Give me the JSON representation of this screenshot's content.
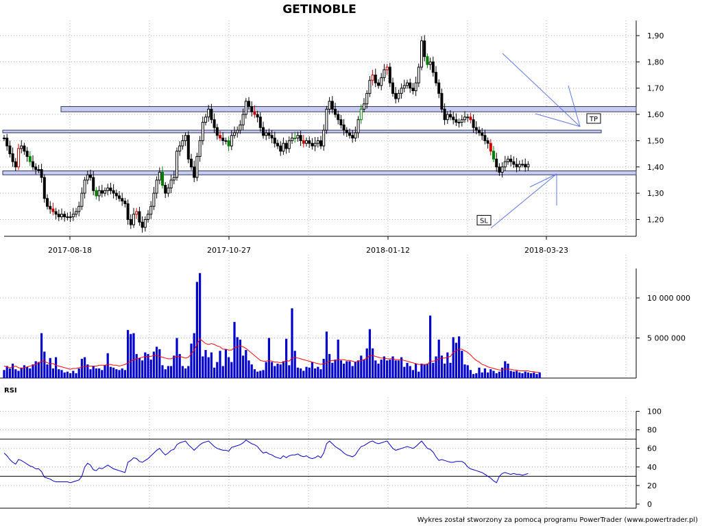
{
  "title": "GETINOBLE",
  "footer": "Wykres został stworzony za pomocą programu PowerTrader (www.powertrader.pl)",
  "colors": {
    "candle_up": "#008000",
    "candle_down": "#cc0000",
    "candle_neutral": "#000000",
    "volume_bar": "#0000cc",
    "volume_ma": "#ff0000",
    "rsi_line": "#0000cc",
    "zone_fill": "#c8cdf0",
    "zone_stroke": "#333366",
    "arrow": "#5a78e6",
    "grid": "#aaaaaa"
  },
  "chart_data": [
    {
      "type": "candlestick",
      "name": "price",
      "title": "GETINOBLE",
      "x_tick_labels": [
        "2017-08-18",
        "2017-10-27",
        "2018-01-12",
        "2018-03-23"
      ],
      "y_tick_labels": [
        "1,90",
        "1,80",
        "1,70",
        "1,60",
        "1,50",
        "1,40",
        "1,30",
        "1,20"
      ],
      "ylim": [
        1.15,
        1.92
      ],
      "grid": true,
      "close": [
        1.51,
        1.48,
        1.45,
        1.42,
        1.4,
        1.47,
        1.48,
        1.46,
        1.44,
        1.42,
        1.4,
        1.39,
        1.39,
        1.36,
        1.28,
        1.25,
        1.24,
        1.23,
        1.22,
        1.21,
        1.22,
        1.21,
        1.21,
        1.21,
        1.22,
        1.23,
        1.25,
        1.3,
        1.35,
        1.37,
        1.36,
        1.31,
        1.29,
        1.31,
        1.3,
        1.31,
        1.32,
        1.31,
        1.3,
        1.29,
        1.28,
        1.27,
        1.26,
        1.2,
        1.18,
        1.22,
        1.23,
        1.19,
        1.17,
        1.2,
        1.22,
        1.25,
        1.3,
        1.35,
        1.38,
        1.33,
        1.3,
        1.32,
        1.35,
        1.36,
        1.46,
        1.48,
        1.5,
        1.52,
        1.43,
        1.4,
        1.36,
        1.44,
        1.5,
        1.57,
        1.59,
        1.62,
        1.58,
        1.55,
        1.52,
        1.51,
        1.5,
        1.5,
        1.48,
        1.52,
        1.53,
        1.54,
        1.56,
        1.6,
        1.65,
        1.63,
        1.61,
        1.6,
        1.59,
        1.55,
        1.52,
        1.53,
        1.52,
        1.51,
        1.49,
        1.48,
        1.46,
        1.49,
        1.47,
        1.5,
        1.51,
        1.51,
        1.52,
        1.5,
        1.49,
        1.5,
        1.49,
        1.48,
        1.49,
        1.5,
        1.48,
        1.54,
        1.62,
        1.65,
        1.62,
        1.6,
        1.58,
        1.56,
        1.54,
        1.53,
        1.52,
        1.51,
        1.53,
        1.58,
        1.62,
        1.64,
        1.68,
        1.73,
        1.75,
        1.72,
        1.71,
        1.74,
        1.77,
        1.78,
        1.72,
        1.68,
        1.66,
        1.68,
        1.7,
        1.71,
        1.72,
        1.7,
        1.69,
        1.72,
        1.78,
        1.88,
        1.82,
        1.79,
        1.8,
        1.76,
        1.72,
        1.68,
        1.62,
        1.58,
        1.6,
        1.59,
        1.58,
        1.57,
        1.57,
        1.58,
        1.59,
        1.59,
        1.58,
        1.55,
        1.54,
        1.53,
        1.52,
        1.5,
        1.49,
        1.46,
        1.43,
        1.4,
        1.38,
        1.4,
        1.42,
        1.43,
        1.42,
        1.41,
        1.4,
        1.41,
        1.41,
        1.4,
        1.41
      ],
      "overlays": [
        {
          "kind": "horizontal_band",
          "y_range": [
            1.61,
            1.63
          ]
        },
        {
          "kind": "horizontal_band",
          "y_range": [
            1.53,
            1.54
          ]
        },
        {
          "kind": "horizontal_band",
          "y_range": [
            1.37,
            1.385
          ]
        }
      ],
      "annotations": [
        {
          "text": "TP",
          "y": 1.58
        },
        {
          "text": "SL",
          "y": 1.2
        }
      ]
    },
    {
      "type": "bar",
      "name": "volume",
      "y_tick_labels": [
        "10 000 000",
        "5 000 000"
      ],
      "ylim": [
        0,
        13500000
      ],
      "values": [
        1000000,
        1500000,
        1200000,
        1800000,
        1100000,
        900000,
        1300000,
        1600000,
        1400000,
        1200000,
        1700000,
        2100000,
        2000000,
        5600000,
        3300000,
        1700000,
        2500000,
        1200000,
        2600000,
        1100000,
        1000000,
        700000,
        800000,
        600000,
        900000,
        600000,
        1200000,
        2400000,
        2600000,
        1700000,
        1100000,
        1500000,
        1200000,
        1200000,
        1000000,
        1600000,
        3100000,
        1400000,
        1300000,
        1100000,
        1000000,
        1200000,
        1000000,
        6000000,
        5500000,
        5600000,
        3000000,
        2500000,
        2200000,
        3200000,
        3000000,
        2300000,
        3300000,
        3900000,
        3600000,
        1600000,
        1100000,
        1500000,
        1500000,
        2800000,
        5000000,
        3000000,
        1500000,
        1200000,
        1500000,
        4300000,
        5600000,
        12000000,
        13100000,
        2700000,
        3500000,
        2600000,
        3200000,
        1300000,
        2000000,
        3400000,
        1500000,
        3600000,
        2600000,
        2000000,
        7000000,
        5100000,
        4800000,
        2800000,
        3500000,
        2200000,
        1700000,
        1100000,
        800000,
        900000,
        1000000,
        2000000,
        5000000,
        2000000,
        1500000,
        1800000,
        1700000,
        2100000,
        4900000,
        1600000,
        8700000,
        3400000,
        1300000,
        1200000,
        900000,
        1400000,
        1300000,
        2000000,
        1200000,
        1400000,
        1100000,
        2400000,
        5800000,
        3000000,
        1900000,
        2300000,
        4800000,
        2200000,
        1800000,
        2100000,
        2100000,
        1500000,
        2000000,
        2200000,
        2800000,
        2300000,
        3700000,
        6100000,
        3700000,
        2200000,
        1800000,
        2300000,
        2700000,
        2200000,
        2300000,
        2700000,
        2200000,
        2200000,
        2600000,
        1400000,
        1900000,
        1500000,
        1000000,
        1800000,
        800000,
        1800000,
        1700000,
        1800000,
        7800000,
        1900000,
        2700000,
        4800000,
        2800000,
        1800000,
        3200000,
        1900000,
        5100000,
        4400000,
        5200000,
        3400000,
        1700000,
        1600000,
        1000000,
        500000,
        600000,
        1300000,
        700000,
        1200000,
        700000,
        1100000,
        900000,
        600000,
        800000,
        1300000,
        2100000,
        1800000,
        900000,
        800000,
        900000,
        700000,
        600000,
        800000,
        700000,
        600000,
        700000,
        500000,
        700000
      ],
      "moving_average": [
        1500000,
        1400000,
        1300000,
        1400000,
        1500000,
        1300000,
        1200000,
        1300000,
        1400000,
        1500000,
        1600000,
        1700000,
        1900000,
        2100000,
        2100000,
        1900000,
        1800000,
        1800000,
        1600000,
        1500000,
        1400000,
        1300000,
        1200000,
        1100000,
        1200000,
        1200000,
        1300000,
        1400000,
        1400000,
        1500000,
        1500000,
        1500000,
        1500000,
        1600000,
        1600000,
        1600000,
        1700000,
        1700000,
        1600000,
        1600000,
        1500000,
        1600000,
        1700000,
        1900000,
        2100000,
        2300000,
        2400000,
        2500000,
        2600000,
        2700000,
        2700000,
        2700000,
        2800000,
        2800000,
        2700000,
        2600000,
        2500000,
        2400000,
        2400000,
        2600000,
        2700000,
        2700000,
        2600000,
        2500000,
        2600000,
        3000000,
        3500000,
        4200000,
        4900000,
        4600000,
        4300000,
        4200000,
        4300000,
        4200000,
        4000000,
        3900000,
        3600000,
        3600000,
        3500000,
        3500000,
        3800000,
        3900000,
        4000000,
        3900000,
        3700000,
        3400000,
        3100000,
        2800000,
        2500000,
        2200000,
        2100000,
        2100000,
        2200000,
        2100000,
        2000000,
        2000000,
        1900000,
        2000000,
        2200000,
        2100000,
        2500000,
        2600000,
        2500000,
        2400000,
        2300000,
        2200000,
        2100000,
        2000000,
        1900000,
        1800000,
        1700000,
        1800000,
        1900000,
        2100000,
        2200000,
        2200000,
        2300000,
        2300000,
        2300000,
        2200000,
        2200000,
        2100000,
        2000000,
        2100000,
        2200000,
        2300000,
        2500000,
        2800000,
        2800000,
        2700000,
        2600000,
        2500000,
        2500000,
        2400000,
        2400000,
        2400000,
        2300000,
        2300000,
        2300000,
        2200000,
        2100000,
        2000000,
        1900000,
        1800000,
        1700000,
        1700000,
        1700000,
        1700000,
        2100000,
        2100000,
        2200000,
        2400000,
        2500000,
        2500000,
        2600000,
        2700000,
        3200000,
        3400000,
        3600000,
        3600000,
        3400000,
        3200000,
        2900000,
        2500000,
        2200000,
        2000000,
        1700000,
        1600000,
        1400000,
        1300000,
        1200000,
        1100000,
        1000000,
        1000000,
        1100000,
        1100000,
        1100000,
        1000000,
        1000000,
        900000,
        900000,
        900000,
        900000,
        800000,
        800000,
        700000,
        700000
      ]
    },
    {
      "type": "line",
      "name": "RSI",
      "title": "RSI",
      "y_tick_labels": [
        "100",
        "80",
        "60",
        "40",
        "20",
        "0"
      ],
      "ylim": [
        0,
        100
      ],
      "reference_lines": [
        70,
        30
      ],
      "values": [
        55,
        52,
        48,
        45,
        43,
        48,
        47,
        45,
        43,
        41,
        40,
        38,
        38,
        35,
        29,
        28,
        27,
        25,
        24,
        24,
        24,
        24,
        24,
        23,
        24,
        25,
        26,
        30,
        40,
        44,
        42,
        37,
        36,
        39,
        38,
        40,
        42,
        40,
        38,
        37,
        36,
        35,
        34,
        45,
        47,
        50,
        49,
        46,
        45,
        47,
        49,
        52,
        55,
        58,
        60,
        56,
        53,
        55,
        58,
        59,
        64,
        66,
        67,
        68,
        64,
        61,
        58,
        61,
        64,
        66,
        67,
        68,
        65,
        62,
        60,
        59,
        58,
        58,
        57,
        61,
        62,
        63,
        64,
        66,
        69,
        67,
        65,
        64,
        62,
        58,
        55,
        56,
        54,
        53,
        51,
        50,
        49,
        52,
        50,
        52,
        53,
        53,
        54,
        52,
        51,
        52,
        50,
        49,
        50,
        52,
        50,
        55,
        65,
        68,
        65,
        62,
        60,
        58,
        55,
        53,
        52,
        51,
        53,
        58,
        62,
        63,
        65,
        67,
        68,
        66,
        65,
        66,
        67,
        68,
        64,
        60,
        58,
        59,
        60,
        61,
        62,
        61,
        60,
        62,
        65,
        68,
        64,
        60,
        59,
        56,
        51,
        47,
        48,
        47,
        46,
        45,
        45,
        46,
        46,
        46,
        44,
        40,
        38,
        37,
        36,
        35,
        34,
        32,
        30,
        28,
        25,
        23,
        30,
        33,
        34,
        33,
        32,
        33,
        32,
        32,
        31,
        32,
        33
      ]
    }
  ]
}
